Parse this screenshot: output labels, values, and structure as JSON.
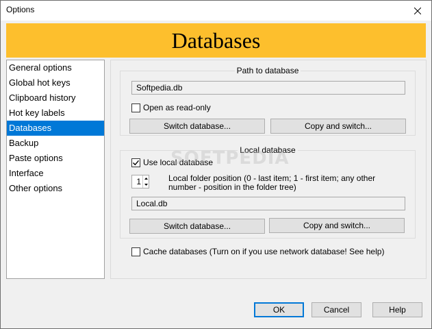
{
  "window": {
    "title": "Options"
  },
  "banner": {
    "title": "Databases"
  },
  "nav": {
    "items": [
      "General options",
      "Global hot keys",
      "Clipboard history",
      "Hot key labels",
      "Databases",
      "Backup",
      "Paste options",
      "Interface",
      "Other options"
    ],
    "selected": "Databases"
  },
  "path_group": {
    "title": "Path to database",
    "path_value": "Softpedia.db",
    "readonly_label": "Open as read-only",
    "readonly_checked": false,
    "switch_label": "Switch database...",
    "copy_switch_label": "Copy and switch..."
  },
  "local_group": {
    "title": "Local database",
    "use_local_label": "Use local database",
    "use_local_checked": true,
    "position_value": "1",
    "position_desc": "Local folder position (0 - last item; 1 - first item; any other number - position in the folder tree)",
    "path_value": "Local.db",
    "switch_label": "Switch database...",
    "copy_switch_label": "Copy and switch..."
  },
  "cache": {
    "label": "Cache databases (Turn on if you use network database! See help)",
    "checked": false
  },
  "footer": {
    "ok_label": "OK",
    "cancel_label": "Cancel",
    "help_label": "Help"
  },
  "watermark": "SOFTPEDIA"
}
